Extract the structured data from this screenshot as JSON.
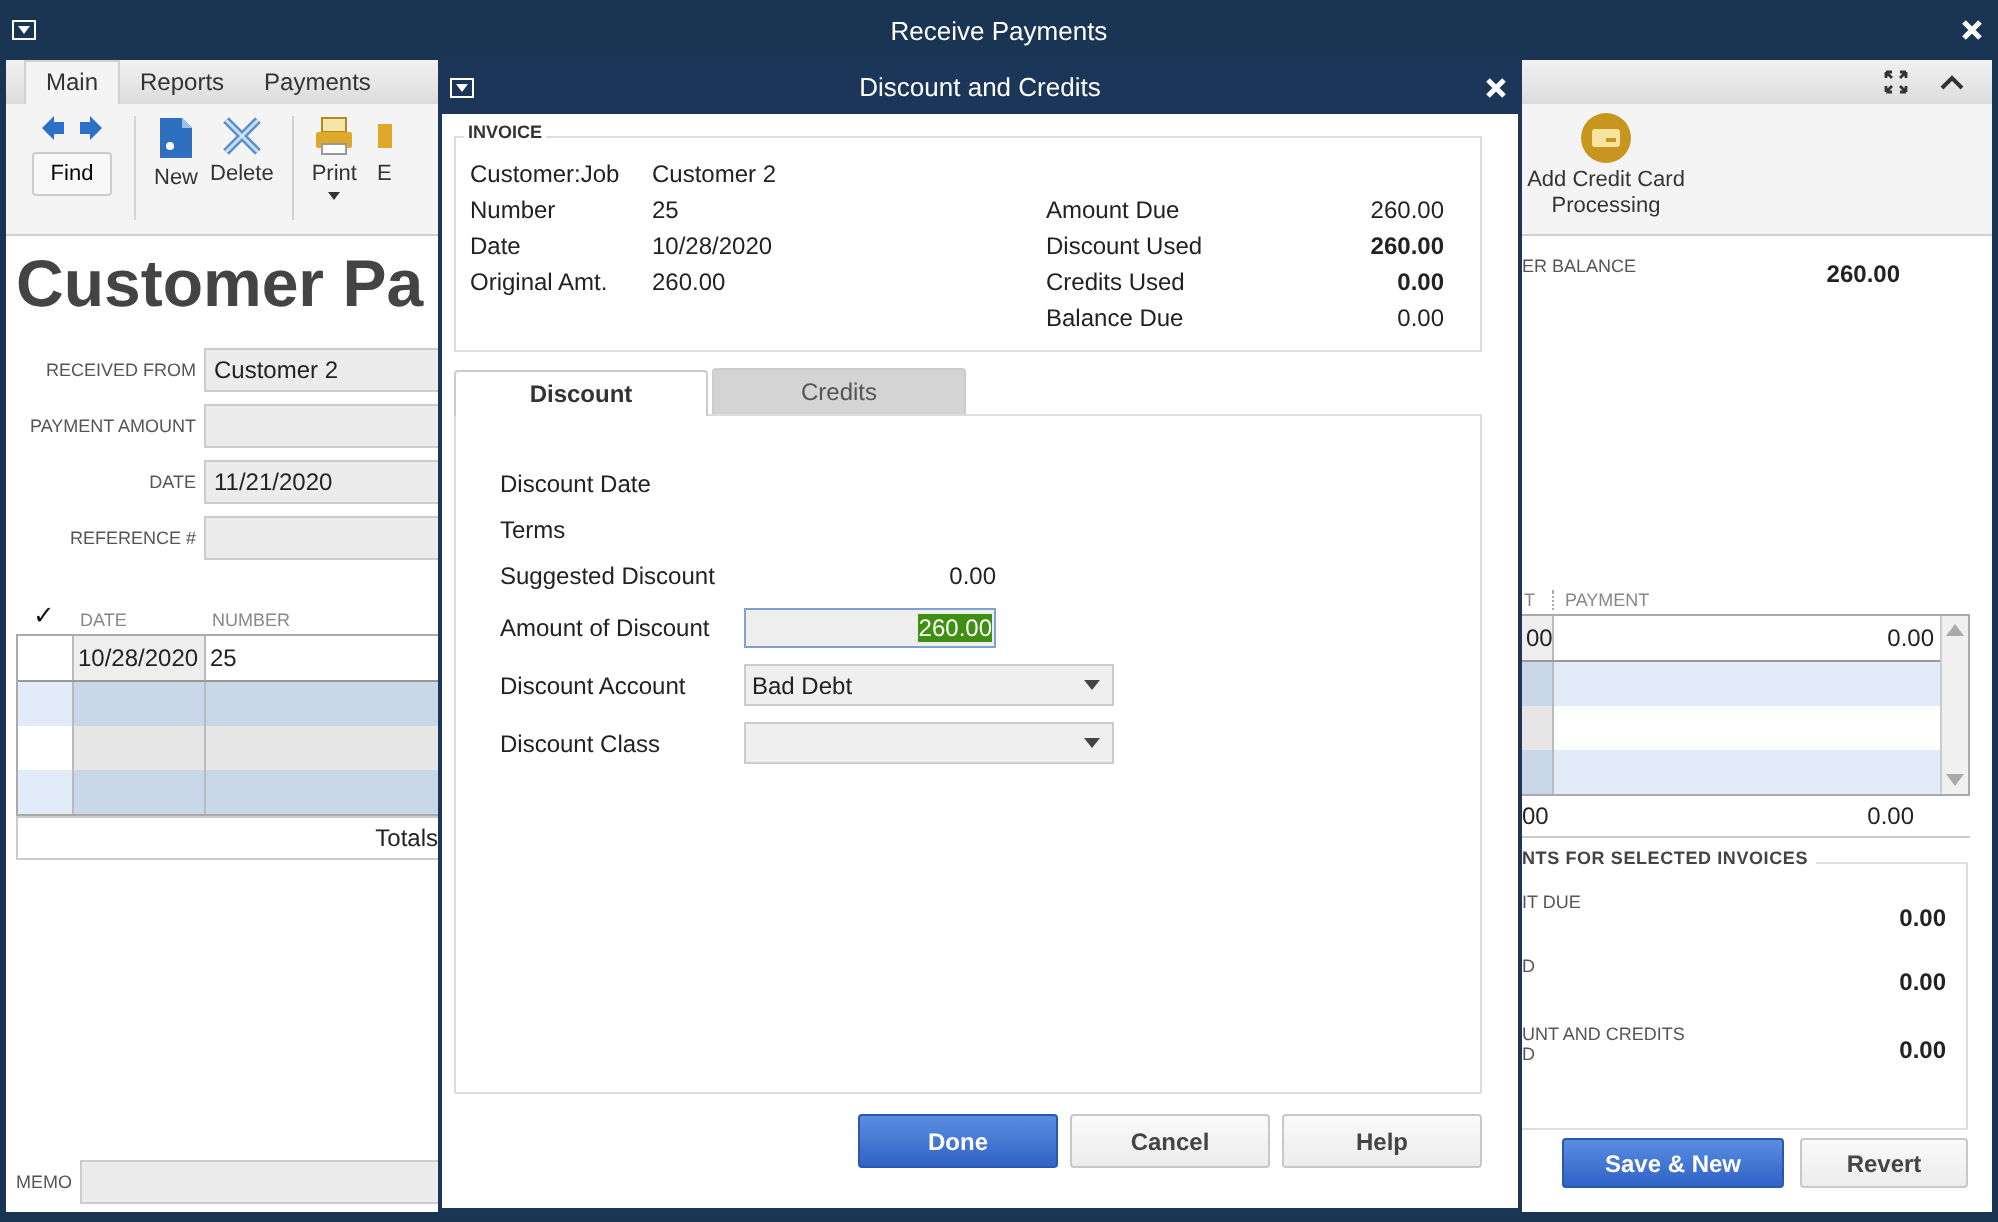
{
  "window": {
    "title": "Receive Payments"
  },
  "tabs": [
    {
      "label": "Main",
      "selected": true
    },
    {
      "label": "Reports",
      "selected": false
    },
    {
      "label": "Payments",
      "selected": false
    }
  ],
  "toolbar": {
    "find": "Find",
    "buttons": [
      {
        "label": "New",
        "kind": "new"
      },
      {
        "label": "Delete",
        "kind": "delete"
      },
      {
        "label": "Print",
        "kind": "print"
      },
      {
        "label": "E",
        "kind": "email"
      }
    ],
    "credit_card": "Add Credit Card Processing"
  },
  "heading": "Customer Pa",
  "form": [
    {
      "label": "RECEIVED FROM",
      "value": "Customer 2"
    },
    {
      "label": "PAYMENT AMOUNT"
    },
    {
      "label": "DATE",
      "value": "11/21/2020"
    },
    {
      "label": "REFERENCE #"
    }
  ],
  "balance": {
    "label": "ER BALANCE",
    "value": "260.00"
  },
  "table": {
    "check_header": "✓",
    "left_columns": [
      "DATE",
      "NUMBER"
    ],
    "right_columns": [
      "T",
      "PAYMENT"
    ],
    "rows": [
      {
        "date": "10/28/2020",
        "number": "25",
        "amount": "00",
        "payment": "0.00"
      }
    ],
    "totals": {
      "label": "Totals",
      "amount": "00",
      "payment": "0.00"
    }
  },
  "amounts": {
    "title": "NTS FOR SELECTED INVOICES",
    "rows": [
      {
        "label": [
          "IT DUE"
        ],
        "value": "0.00"
      },
      {
        "label": [
          "D"
        ],
        "value": "0.00"
      },
      {
        "label": [
          "UNT AND CREDITS",
          "D"
        ],
        "value": "0.00"
      }
    ]
  },
  "memo": {
    "label": "MEMO"
  },
  "footer_buttons": [
    {
      "label": "Save & New",
      "kind": "primary"
    },
    {
      "label": "Revert",
      "kind": "normal"
    }
  ],
  "dialog": {
    "title": "Discount and Credits",
    "invoice": {
      "title": "INVOICE",
      "left": [
        {
          "label": "Customer:Job",
          "value": "Customer 2"
        },
        {
          "label": "Number",
          "value": "25"
        },
        {
          "label": "Date",
          "value": "10/28/2020"
        },
        {
          "label": "Original Amt.",
          "value": "260.00"
        }
      ],
      "right": [
        {
          "label": "Amount Due",
          "value": "260.00",
          "bold": false
        },
        {
          "label": "Discount Used",
          "value": "260.00",
          "bold": true
        },
        {
          "label": "Credits Used",
          "value": "0.00",
          "bold": true
        },
        {
          "label": "Balance Due",
          "value": "0.00",
          "bold": false
        }
      ]
    },
    "tabs": [
      {
        "label": "Discount",
        "selected": true
      },
      {
        "label": "Credits",
        "selected": false
      }
    ],
    "fields": [
      {
        "label": "Discount Date",
        "kind": "text"
      },
      {
        "label": "Terms",
        "kind": "text"
      },
      {
        "label": "Suggested Discount",
        "kind": "text",
        "value": "0.00"
      },
      {
        "label": "Amount of Discount",
        "kind": "input",
        "value": "260.00"
      },
      {
        "label": "Discount Account",
        "kind": "select",
        "value": "Bad Debt"
      },
      {
        "label": "Discount Class",
        "kind": "select"
      }
    ],
    "buttons": [
      {
        "label": "Done",
        "kind": "primary"
      },
      {
        "label": "Cancel",
        "kind": "normal"
      },
      {
        "label": "Help",
        "kind": "normal"
      }
    ]
  }
}
